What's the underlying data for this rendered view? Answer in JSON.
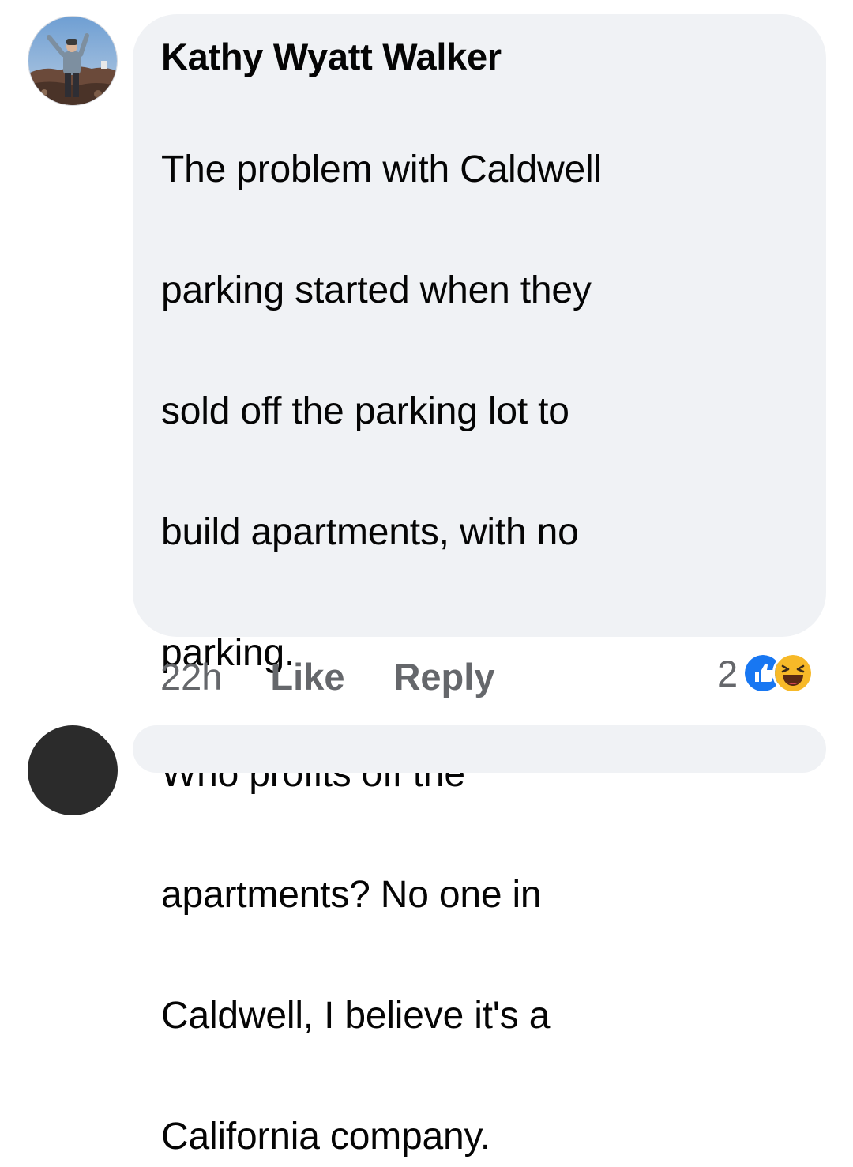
{
  "comment": {
    "author": "Kathy Wyatt Walker",
    "text_lines": [
      "The problem with Caldwell",
      "parking started when they",
      "sold off the parking lot to",
      "build apartments, with no",
      "parking.",
      "Who profits off the",
      "apartments? No one in",
      "Caldwell, I believe it's a",
      "California company."
    ],
    "timestamp": "22h",
    "like_label": "Like",
    "reply_label": "Reply",
    "reaction_count": "2",
    "reaction_icons": [
      "like-icon",
      "haha-icon"
    ]
  },
  "colors": {
    "bubble": "#f0f2f5",
    "text": "#050505",
    "secondary": "#65676b",
    "like_blue": "#1877f2",
    "haha_yellow": "#f7b928"
  }
}
